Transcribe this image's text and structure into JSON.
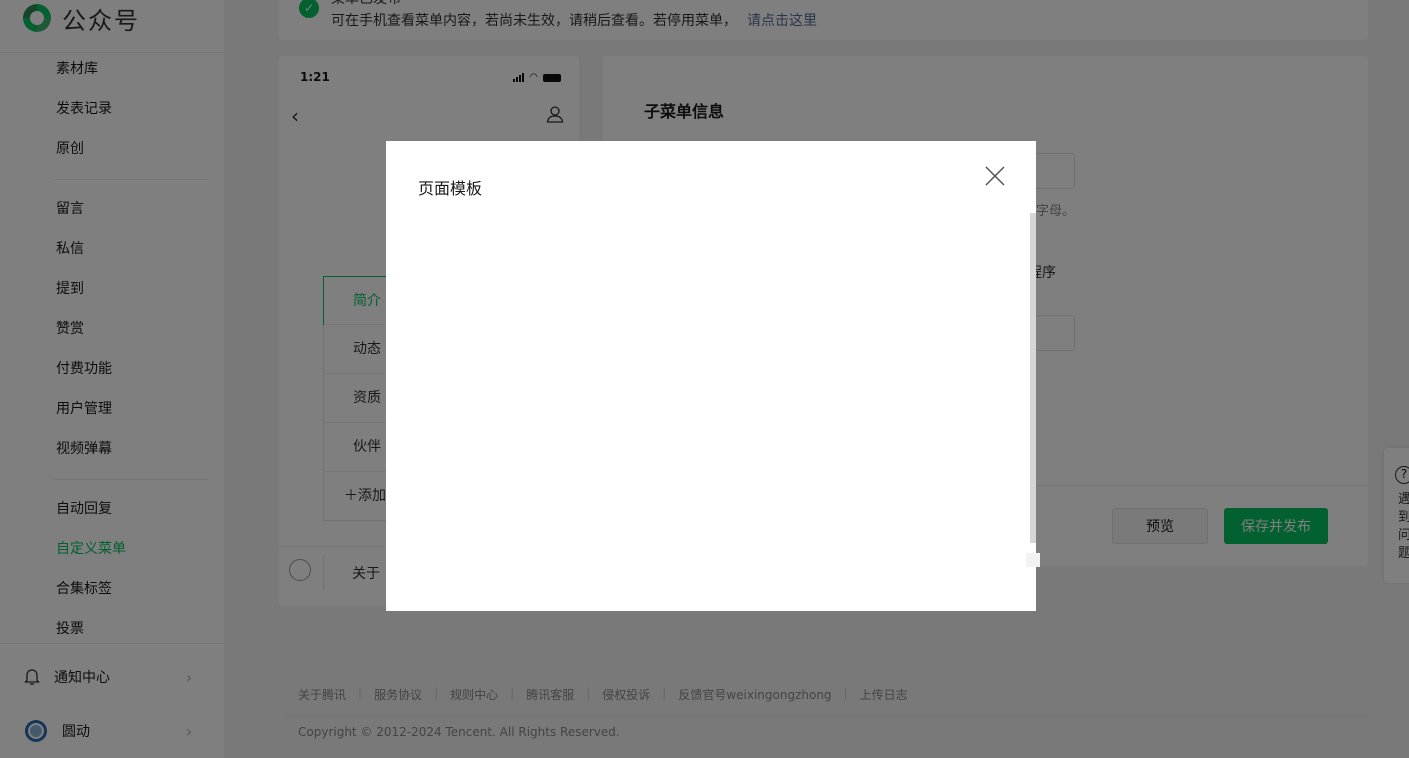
{
  "brand": {
    "logo_text": "公众号"
  },
  "sidebar": {
    "items": [
      {
        "label": "素材库"
      },
      {
        "label": "发表记录"
      },
      {
        "label": "原创"
      },
      {
        "label": "留言"
      },
      {
        "label": "私信"
      },
      {
        "label": "提到"
      },
      {
        "label": "赞赏"
      },
      {
        "label": "付费功能"
      },
      {
        "label": "用户管理"
      },
      {
        "label": "视频弹幕"
      },
      {
        "label": "自动回复"
      },
      {
        "label": "自定义菜单"
      },
      {
        "label": "合集标签"
      },
      {
        "label": "投票"
      }
    ],
    "notification_label": "通知中心",
    "account_name": "圆动"
  },
  "notice": {
    "title": "菜单已发布",
    "text": "可在手机查看菜单内容，若尚未生效，请稍后查看。若停用菜单，",
    "link": "请点击这里"
  },
  "phone": {
    "time": "1:21",
    "submenu": [
      "简介",
      "动态",
      "资质",
      "伙伴"
    ],
    "add_label": "添加",
    "menu_bar_item": "关于"
  },
  "editor": {
    "title": "子菜单信息",
    "hint": "个字母。",
    "radio_label": "程序",
    "preview_button": "预览",
    "publish_button": "保存并发布"
  },
  "footer": {
    "links": [
      "关于腾讯",
      "服务协议",
      "规则中心",
      "腾讯客服",
      "侵权投诉",
      "反馈官号weixingongzhong",
      "上传日志"
    ],
    "copyright": "Copyright © 2012-2024 Tencent. All Rights Reserved."
  },
  "help": {
    "text": "遇到问题"
  },
  "modal": {
    "title": "页面模板"
  },
  "colors": {
    "accent": "#07c160",
    "link": "#576b95",
    "overlay": "rgba(0,0,0,0.5)"
  }
}
